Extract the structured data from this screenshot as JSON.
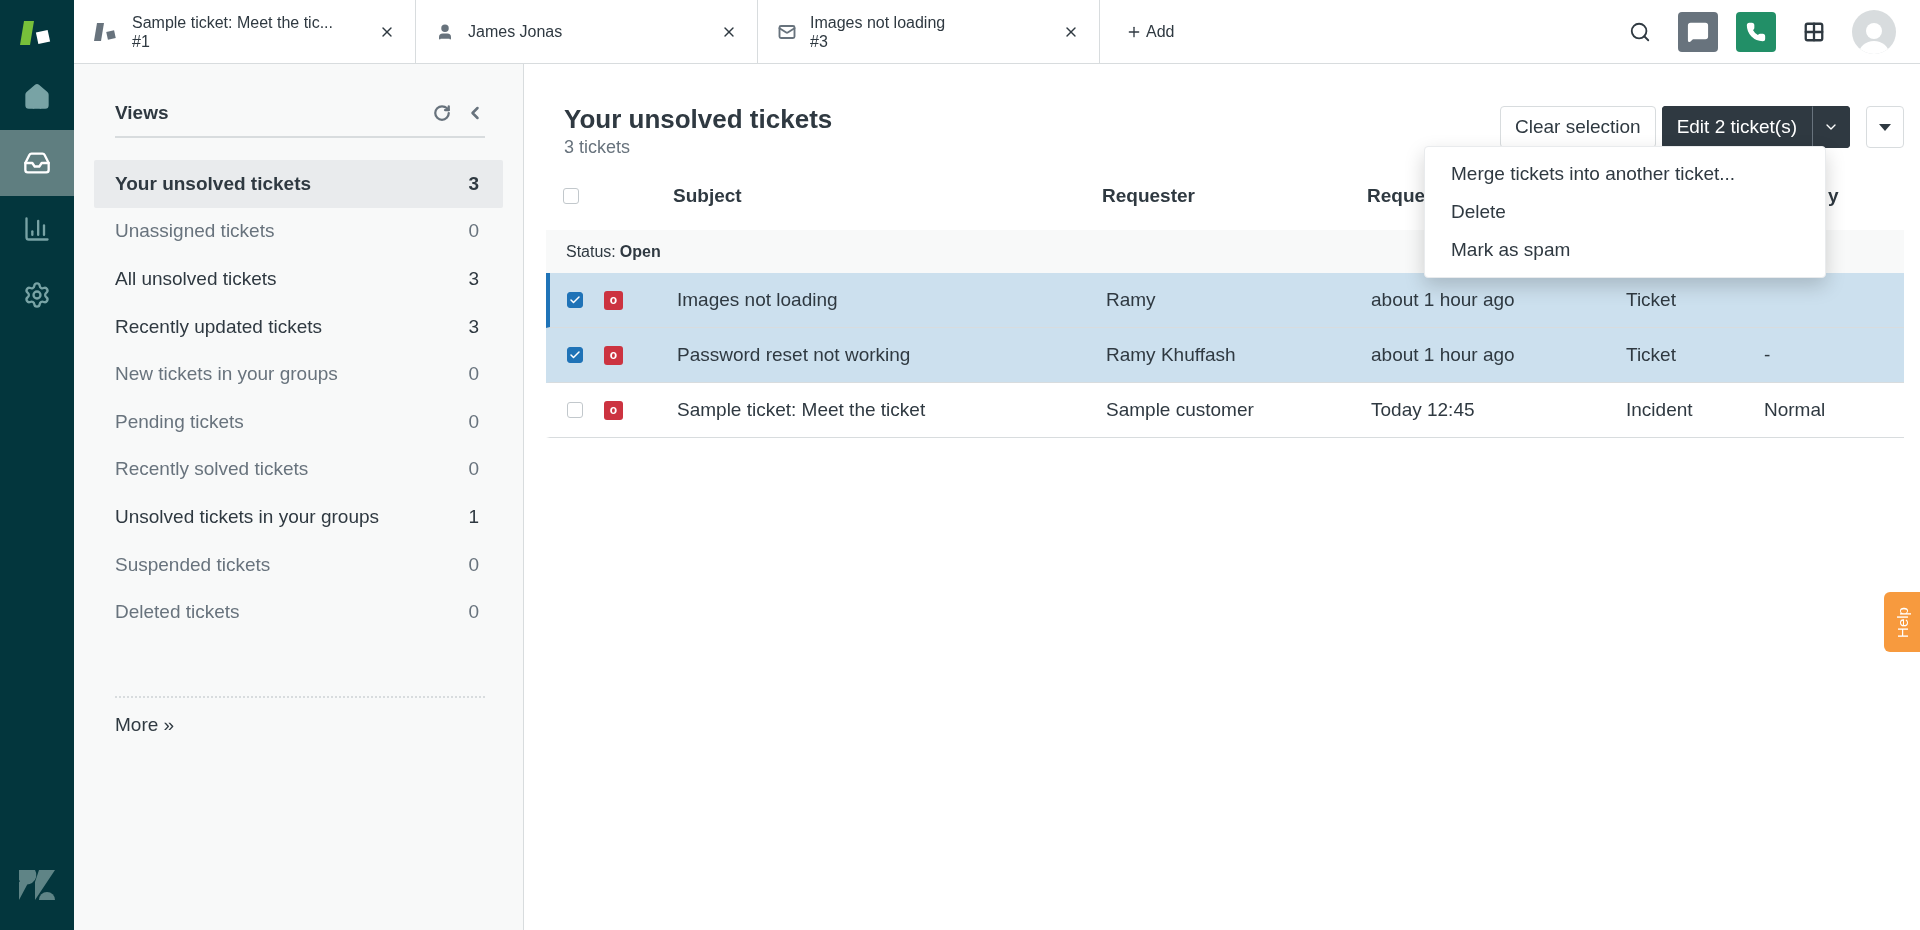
{
  "tabs": [
    {
      "kind": "ticket",
      "title": "Sample ticket: Meet the tic...",
      "subtitle": "#1"
    },
    {
      "kind": "user",
      "title": "James Jonas"
    },
    {
      "kind": "mail",
      "title": "Images not loading",
      "subtitle": "#3"
    }
  ],
  "add_tab": "Add",
  "nav": [
    {
      "kind": "home",
      "selected": false
    },
    {
      "kind": "views",
      "selected": true
    },
    {
      "kind": "reports",
      "selected": false
    },
    {
      "kind": "admin",
      "selected": false
    }
  ],
  "views": {
    "title": "Views",
    "items": [
      {
        "label": "Your unsolved tickets",
        "count": "3",
        "selected": true,
        "empty": false
      },
      {
        "label": "Unassigned tickets",
        "count": "0",
        "selected": false,
        "empty": true
      },
      {
        "label": "All unsolved tickets",
        "count": "3",
        "selected": false,
        "empty": false
      },
      {
        "label": "Recently updated tickets",
        "count": "3",
        "selected": false,
        "empty": false
      },
      {
        "label": "New tickets in your groups",
        "count": "0",
        "selected": false,
        "empty": true
      },
      {
        "label": "Pending tickets",
        "count": "0",
        "selected": false,
        "empty": true
      },
      {
        "label": "Recently solved tickets",
        "count": "0",
        "selected": false,
        "empty": true
      },
      {
        "label": "Unsolved tickets in your groups",
        "count": "1",
        "selected": false,
        "empty": false
      },
      {
        "label": "Suspended tickets",
        "count": "0",
        "selected": false,
        "empty": true
      },
      {
        "label": "Deleted tickets",
        "count": "0",
        "selected": false,
        "empty": true
      }
    ],
    "more": "More »"
  },
  "header": {
    "title": "Your unsolved tickets",
    "subtitle": "3 tickets",
    "clear_button": "Clear selection",
    "edit_button": "Edit 2 ticket(s)"
  },
  "menu": [
    "Merge tickets into another ticket...",
    "Delete",
    "Mark as spam"
  ],
  "table": {
    "all_checked": false,
    "columns": {
      "subject": "Subject",
      "requester": "Requester",
      "column_3": "Reque",
      "column_5": "y"
    },
    "group": {
      "label": "Status:",
      "value": "Open"
    },
    "rows": [
      {
        "checked": true,
        "badge": "o",
        "subject": "Images not loading",
        "requester": "Ramy",
        "requested": "about 1 hour ago",
        "type": "Ticket"
      },
      {
        "checked": true,
        "badge": "o",
        "subject": "Password reset not working",
        "requester": "Ramy Khuffash",
        "requested": "about 1 hour ago",
        "type": "Ticket",
        "priority": "-"
      },
      {
        "checked": false,
        "badge": "o",
        "subject": "Sample ticket: Meet the ticket",
        "requester": "Sample customer",
        "requested": "Today 12:45",
        "type": "Incident",
        "priority": "Normal"
      }
    ]
  },
  "help_tab": "Help"
}
